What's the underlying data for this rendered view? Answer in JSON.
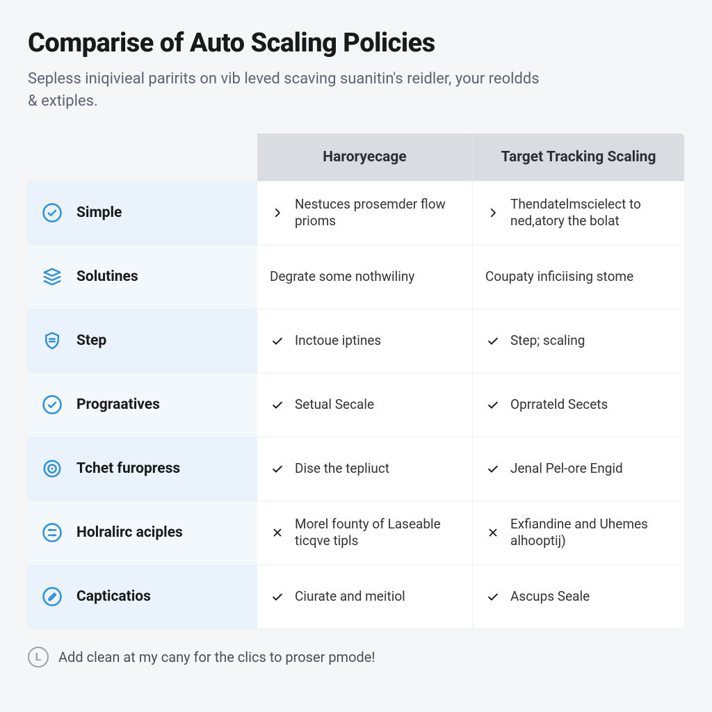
{
  "title": "Comparise of Auto Scaling Policies",
  "subtitle": "Sepless iniqivieal paririts on vib leved scaving suanitin's reidler, your reoldds & extiples.",
  "columns": {
    "a": "Haroryecage",
    "b": "Target Tracking Scaling"
  },
  "rows": [
    {
      "icon": "check-circle",
      "label": "Simple",
      "a": {
        "mark": "chevron",
        "text": "Nestuces prosemder flow prioms"
      },
      "b": {
        "mark": "chevron",
        "text": "Thendatelmscielect to ned,atory the bolat"
      }
    },
    {
      "icon": "stack",
      "label": "Solutines",
      "a": {
        "mark": "none",
        "text": "Degrate some nothwiliny"
      },
      "b": {
        "mark": "none",
        "text": "Coupaty inficiising stome"
      }
    },
    {
      "icon": "shield-list",
      "label": "Step",
      "a": {
        "mark": "check",
        "text": "Inctoue iptines"
      },
      "b": {
        "mark": "check",
        "text": "Step; scaling"
      }
    },
    {
      "icon": "check-circle",
      "label": "Prograatives",
      "a": {
        "mark": "check",
        "text": "Setual Secale"
      },
      "b": {
        "mark": "check",
        "text": "Oprrateld Secets"
      }
    },
    {
      "icon": "target",
      "label": "Tchet furopress",
      "a": {
        "mark": "check",
        "text": "Dise the tepliuct"
      },
      "b": {
        "mark": "check",
        "text": "Jenal Pel-ore Engid"
      }
    },
    {
      "icon": "sliders",
      "label": "Holralirc aciples",
      "a": {
        "mark": "cross",
        "text": "Morel founty of Laseable ticqve tipls"
      },
      "b": {
        "mark": "cross",
        "text": "Exfiandine and Uhemes alhooptij)"
      }
    },
    {
      "icon": "pencil-circle",
      "label": "Capticatios",
      "a": {
        "mark": "check",
        "text": "Ciurate and meitiol"
      },
      "b": {
        "mark": "check",
        "text": "Ascups Seale"
      }
    }
  ],
  "footer": "Add clean at my cany for the clics to proser pmode!",
  "footer_badge": "L"
}
